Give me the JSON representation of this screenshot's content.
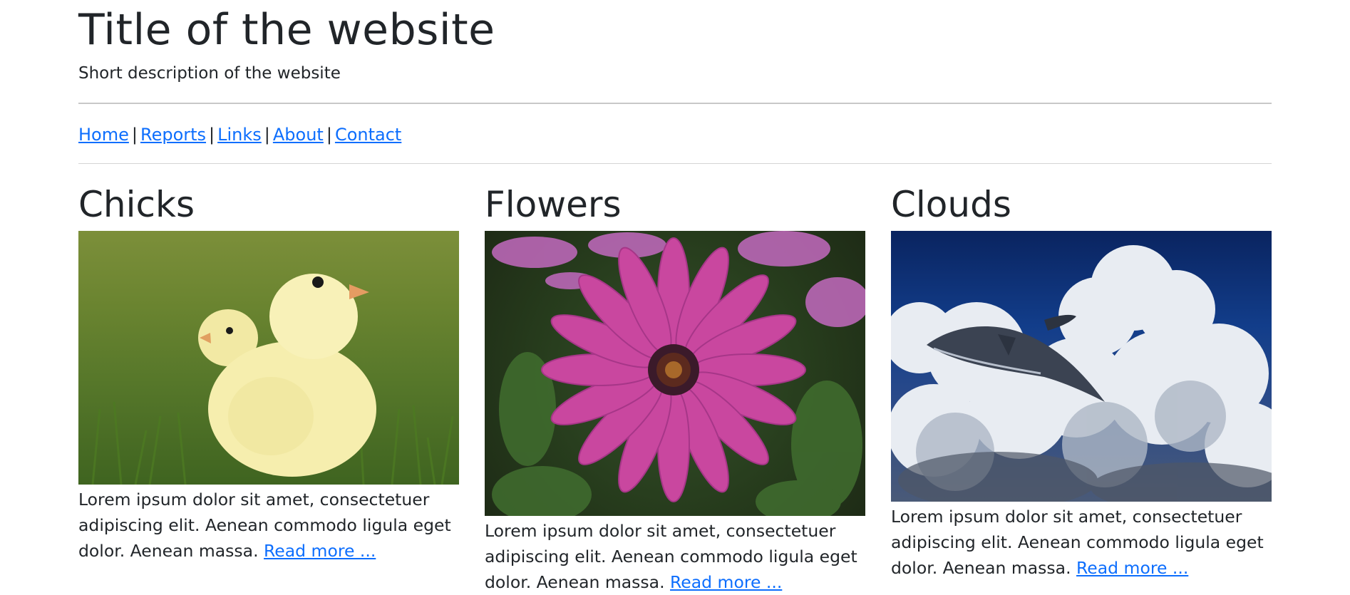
{
  "header": {
    "title": "Title of the website",
    "description": "Short description of the website"
  },
  "nav": {
    "links": [
      "Home",
      "Reports",
      "Links",
      "About",
      "Contact"
    ],
    "separator": "|"
  },
  "articles": [
    {
      "heading": "Chicks",
      "image_icon": "chicks-image",
      "text": "Lorem ipsum dolor sit amet, consectetuer adipiscing elit. Aenean commodo ligula eget dolor. Aenean massa.",
      "read_more": "Read more ..."
    },
    {
      "heading": "Flowers",
      "image_icon": "flower-image",
      "text": "Lorem ipsum dolor sit amet, consectetuer adipiscing elit. Aenean commodo ligula eget dolor. Aenean massa.",
      "read_more": "Read more ..."
    },
    {
      "heading": "Clouds",
      "image_icon": "clouds-whale-image",
      "text": "Lorem ipsum dolor sit amet, consectetuer adipiscing elit. Aenean commodo ligula eget dolor. Aenean massa.",
      "read_more": "Read more ..."
    }
  ],
  "colors": {
    "text": "#212529",
    "link": "#0d6efd",
    "background": "#ffffff"
  }
}
